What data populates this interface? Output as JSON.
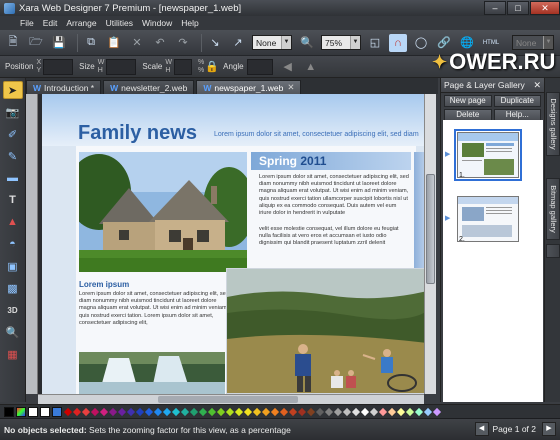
{
  "window": {
    "title": "Xara Web Designer 7 Premium - [newspaper_1.web]"
  },
  "menu": [
    {
      "label": "File"
    },
    {
      "label": "Edit"
    },
    {
      "label": "Arrange"
    },
    {
      "label": "Utilities"
    },
    {
      "label": "Window"
    },
    {
      "label": "Help"
    }
  ],
  "toolbar": {
    "line_dropdown": "None",
    "zoom_dropdown": "75%",
    "html_label": "HTML",
    "right_dropdown": "None"
  },
  "infobar": {
    "position_label": "Position",
    "size_label": "Size",
    "scale_label": "Scale",
    "angle_label": "Angle",
    "x_label": "X",
    "y_label": "Y",
    "w_label": "W",
    "h_label": "H",
    "pct_label": "%"
  },
  "watermark": {
    "text": "OWER.RU"
  },
  "tabs": [
    {
      "label": "Introduction *",
      "icon": "W"
    },
    {
      "label": "newsletter_2.web",
      "icon": "W"
    },
    {
      "label": "newspaper_1.web",
      "icon": "W",
      "active": true
    }
  ],
  "document": {
    "title": "Family news",
    "subtitle": "Lorem ipsum dolor sit amet, consectetuer adipiscing elit, sed diam",
    "spring_word": "Spring",
    "spring_year": "2011",
    "spring_text_1": "Lorem ipsum dolor sit amet, consectetuer adipiscing elit, sed diam nonummy nibh euismod tincidunt ut laoreet dolore magna aliquam erat volutpat. Ut wisi enim ad minim veniam, quis nostrud exerci tation ullamcorper suscipit lobortis nisl ut aliquip ex ea commodo consequat. Duis autem vel eum iriure dolor in hendrerit in vulputate",
    "spring_text_2": "velit esse molestie consequat, vel illum dolore eu feugiat nulla facilisis at vero eros et accumsan et iusto odio dignissim qui blandit praesent luptatum zzril delenit",
    "lorem_heading": "Lorem ipsum",
    "lorem_text": "Lorem ipsum dolor sit amet, consectetuer adipiscing elit, sed diam nonummy nibh euismod tincidunt ut laoreet dolore magna aliquam erat volutpat. Ut wisi enim ad minim veniam, quis nostrud exerci tation. Lorem ipsum dolor sit amet, consectetuer adipiscing elit,"
  },
  "gallery": {
    "title": "Page & Layer Gallery",
    "buttons": [
      "New page",
      "Duplicate",
      "Delete",
      "Help..."
    ],
    "pages": [
      {
        "num": "1."
      },
      {
        "num": "2."
      }
    ]
  },
  "side_tabs": [
    "Designs gallery",
    "Bitmap gallery"
  ],
  "status": {
    "bold": "No objects selected:",
    "text": "Sets the zooming factor for this view, as a percentage",
    "page_info": "Page 1 of 2"
  },
  "palette_colors": [
    "#cc0000",
    "#dd2222",
    "#e84040",
    "#c01060",
    "#d02080",
    "#8a1a8a",
    "#6a20a0",
    "#4030b0",
    "#2040c0",
    "#2060e0",
    "#2088f0",
    "#20a8f0",
    "#20c0d0",
    "#20b0a0",
    "#20a070",
    "#30b050",
    "#50c030",
    "#80d020",
    "#b0e020",
    "#d8e820",
    "#f0e020",
    "#f0c020",
    "#f0a020",
    "#f08020",
    "#e06020",
    "#c04020",
    "#a03020",
    "#804020",
    "#606060",
    "#808080",
    "#a0a0a0",
    "#c0c0c0",
    "#e0e0e0",
    "#ffffff",
    "#d0d0d0",
    "#ff9999",
    "#ffcc99",
    "#ffff99",
    "#ccff99",
    "#99ffcc",
    "#99ccff",
    "#cc99ff"
  ]
}
